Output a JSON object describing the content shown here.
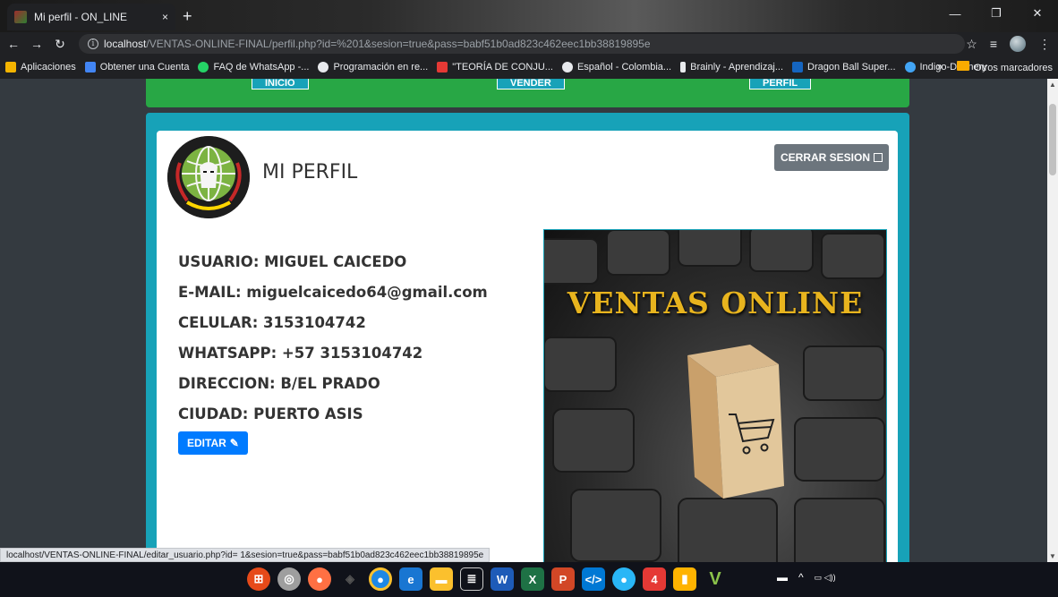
{
  "browser": {
    "tab_title": "Mi perfil - ON_LINE",
    "tab_close": "×",
    "new_tab": "+",
    "url_host": "localhost",
    "url_path": "/VENTAS-ONLINE-FINAL/perfil.php?id=%201&sesion=true&pass=babf51b0ad823c462eec1bb38819895e",
    "bookmarks": [
      {
        "label": "Aplicaciones",
        "color": "#f4b400"
      },
      {
        "label": "Obtener una Cuenta",
        "color": "#4285f4"
      },
      {
        "label": "FAQ de WhatsApp -...",
        "color": "#25d366"
      },
      {
        "label": "Programación en re...",
        "color": "#e8eaed"
      },
      {
        "label": "\"TEORÍA DE CONJU...",
        "color": "#e53935"
      },
      {
        "label": "Español - Colombia...",
        "color": "#e8eaed"
      },
      {
        "label": "Brainly - Aprendizaj...",
        "color": "#e8eaed"
      },
      {
        "label": "Dragon Ball Super...",
        "color": "#1565c0"
      },
      {
        "label": "Indigo-Dannery",
        "color": "#42a5f5"
      }
    ],
    "more_bookmarks": "»",
    "other_bookmarks": "Otros marcadores",
    "status_url": "localhost/VENTAS-ONLINE-FINAL/editar_usuario.php?id= 1&sesion=true&pass=babf51b0ad823c462eec1bb38819895e"
  },
  "nav": {
    "items": [
      "INICIO",
      "VENDER",
      "PERFIL"
    ]
  },
  "profile": {
    "title": "MI PERFIL",
    "logout_label": "CERRAR SESION",
    "fields": [
      "USUARIO: MIGUEL CAICEDO",
      "E-MAIL: miguelcaicedo64@gmail.com",
      "CELULAR: 3153104742",
      "WHATSAPP: +57 3153104742",
      "DIRECCION: B/EL PRADO",
      "CIUDAD: PUERTO ASIS"
    ],
    "edit_label": "EDITAR",
    "promo_text": "VENTAS ONLINE"
  },
  "colors": {
    "nav_green": "#28a745",
    "card_teal": "#17a2b8",
    "logout_gray": "#6c757d",
    "edit_blue": "#007bff",
    "promo_gold": "#e8b41e"
  }
}
